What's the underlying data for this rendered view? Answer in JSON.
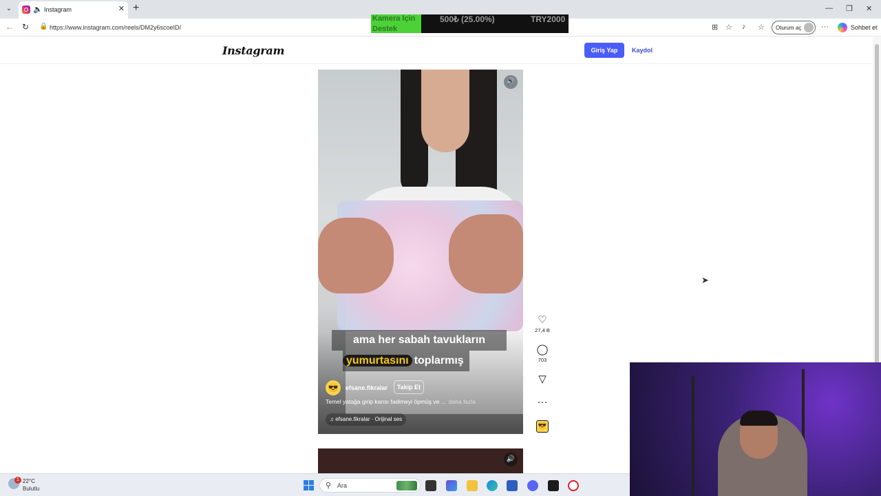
{
  "browser": {
    "tab_title": "Instagram",
    "url": "https://www.instagram.com/reels/DM2y6scoeID/",
    "signin_label": "Oturum aç",
    "copilot_label": "Sohbet et"
  },
  "overlay": {
    "line1": "Kamera İçin",
    "line2": "Destek",
    "amount": "500₺ (25.00%)",
    "goal": "TRY2000"
  },
  "instagram": {
    "logo": "Instagram",
    "login_label": "Giriş Yap",
    "signup_label": "Kaydol"
  },
  "reel": {
    "caption_line1": "ama her sabah tavukların",
    "caption_highlight": "yumurtasını",
    "caption_rest": "toplarmış",
    "username": "efsane.fikralar",
    "follow_label": "Takip Et",
    "description": "Temel yatağa girip karısı fadimeyi öpmüş ve ...",
    "more_label": "daha fazla",
    "audio": "efsane.fikralar · Orijinal ses",
    "likes": "27,4 B",
    "comments": "703"
  },
  "taskbar": {
    "temperature": "22°C",
    "condition": "Bulutlu",
    "weather_badge": "1",
    "search_placeholder": "Ara"
  },
  "icons": {
    "speaker": "🔊",
    "heart": "♡",
    "comment": "◯",
    "share": "▽",
    "more": "···",
    "music": "♫"
  }
}
